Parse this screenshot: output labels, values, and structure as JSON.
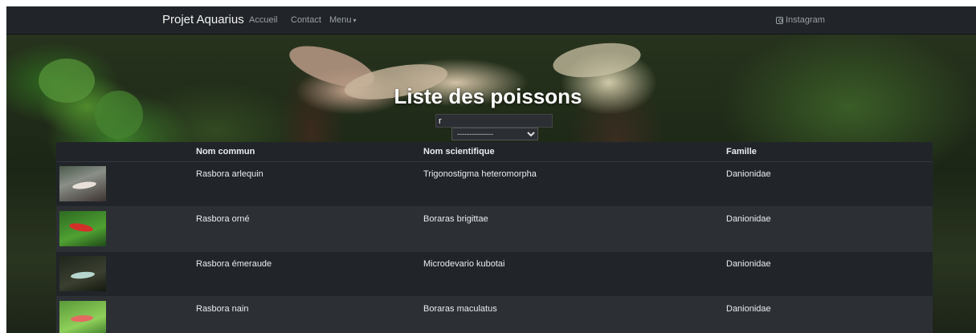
{
  "navbar": {
    "brand": "Projet Aquarius",
    "links": [
      {
        "label": "Accueil"
      },
      {
        "label": "Contact"
      },
      {
        "label": "Menu"
      }
    ],
    "instagram_label": "Instagram"
  },
  "page": {
    "title": "Liste des poissons",
    "search_value": "r",
    "filter_selected": "---------------"
  },
  "table": {
    "headers": [
      "",
      "Nom commun",
      "Nom scientifique",
      "Famille"
    ],
    "rows": [
      {
        "nom_commun": "Rasbora arlequin",
        "nom_scientifique": "Trigonostigma heteromorpha",
        "famille": "Danionidae"
      },
      {
        "nom_commun": "Rasbora orné",
        "nom_scientifique": "Boraras brigittae",
        "famille": "Danionidae"
      },
      {
        "nom_commun": "Rasbora émeraude",
        "nom_scientifique": "Microdevario kubotai",
        "famille": "Danionidae"
      },
      {
        "nom_commun": "Rasbora nain",
        "nom_scientifique": "Boraras maculatus",
        "famille": "Danionidae"
      }
    ]
  },
  "colors": {
    "navbar_bg": "#212529",
    "table_bg": "#212529",
    "table_row_alt": "#2c3034",
    "text": "#e9ecef",
    "nav_link": "#9aa0a6"
  },
  "icons": {
    "instagram": "instagram-icon",
    "menu_caret": "caret-down-icon"
  }
}
